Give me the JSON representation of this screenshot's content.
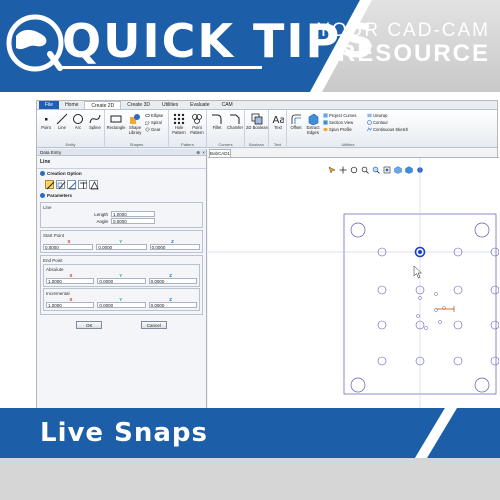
{
  "banner": {
    "title": "QUICK TIPS",
    "resource_top": "YOUR CAD-CAM",
    "resource_bottom": "RESOURCE",
    "colors": {
      "blue": "#1d5ea8",
      "gray": "#d0d0d0"
    }
  },
  "ribbon": {
    "tabs": [
      "File",
      "Home",
      "Create 2D",
      "Create 3D",
      "Utilities",
      "Evaluate",
      "CAM"
    ],
    "active_tab": "Create 2D",
    "groups": {
      "entity": {
        "label": "Entity",
        "tools": [
          "Point",
          "Line",
          "Arc",
          "Spline"
        ]
      },
      "shapes": {
        "label": "Shapes",
        "tools": [
          "Rectangle",
          "Shape Library"
        ],
        "small": [
          "Ellipse",
          "Spiral",
          "Gear"
        ]
      },
      "pattern": {
        "label": "Pattern",
        "tools": [
          "Hole Pattern",
          "Point Pattern"
        ]
      },
      "corners": {
        "label": "Corners",
        "tools": [
          "Fillet",
          "Chamfer"
        ]
      },
      "boolean": {
        "label": "Boolean",
        "tools": [
          "2D Boolean"
        ]
      },
      "text": {
        "label": "Text",
        "tools": [
          "Text"
        ]
      },
      "utilities": {
        "label": "Utilities",
        "tools": [
          "Offset",
          "Extract Edges"
        ],
        "small": [
          "Project Curves",
          "Section View",
          "Spun Profile",
          "Unwrap",
          "Contour",
          "Continuous Sketch"
        ]
      }
    }
  },
  "panel": {
    "header": "Data Entry",
    "pin": "⊕",
    "close": "×",
    "entity": "Line",
    "creation_option": "Creation Option",
    "parameters": "Parameters",
    "line_group": "Line",
    "length_label": "Length",
    "length_value": "1.0000",
    "angle_label": "Angle",
    "angle_value": "0.0000",
    "start_point": "Start Point",
    "end_point": "End Point",
    "absolute": "Absolute",
    "incremental": "Incremental",
    "axis_x": "X",
    "axis_y": "Y",
    "axis_z": "Z",
    "start_values": [
      "0.0000",
      "0.0000",
      "0.0000"
    ],
    "absolute_values": [
      "1.0000",
      "0.0000",
      "0.0000"
    ],
    "incremental_values": [
      "1.0000",
      "0.0000",
      "0.0000"
    ],
    "ok": "OK",
    "cancel": "Cancel"
  },
  "document": {
    "tab": "BobCAD1"
  },
  "bottom": {
    "label": "Live Snaps"
  }
}
